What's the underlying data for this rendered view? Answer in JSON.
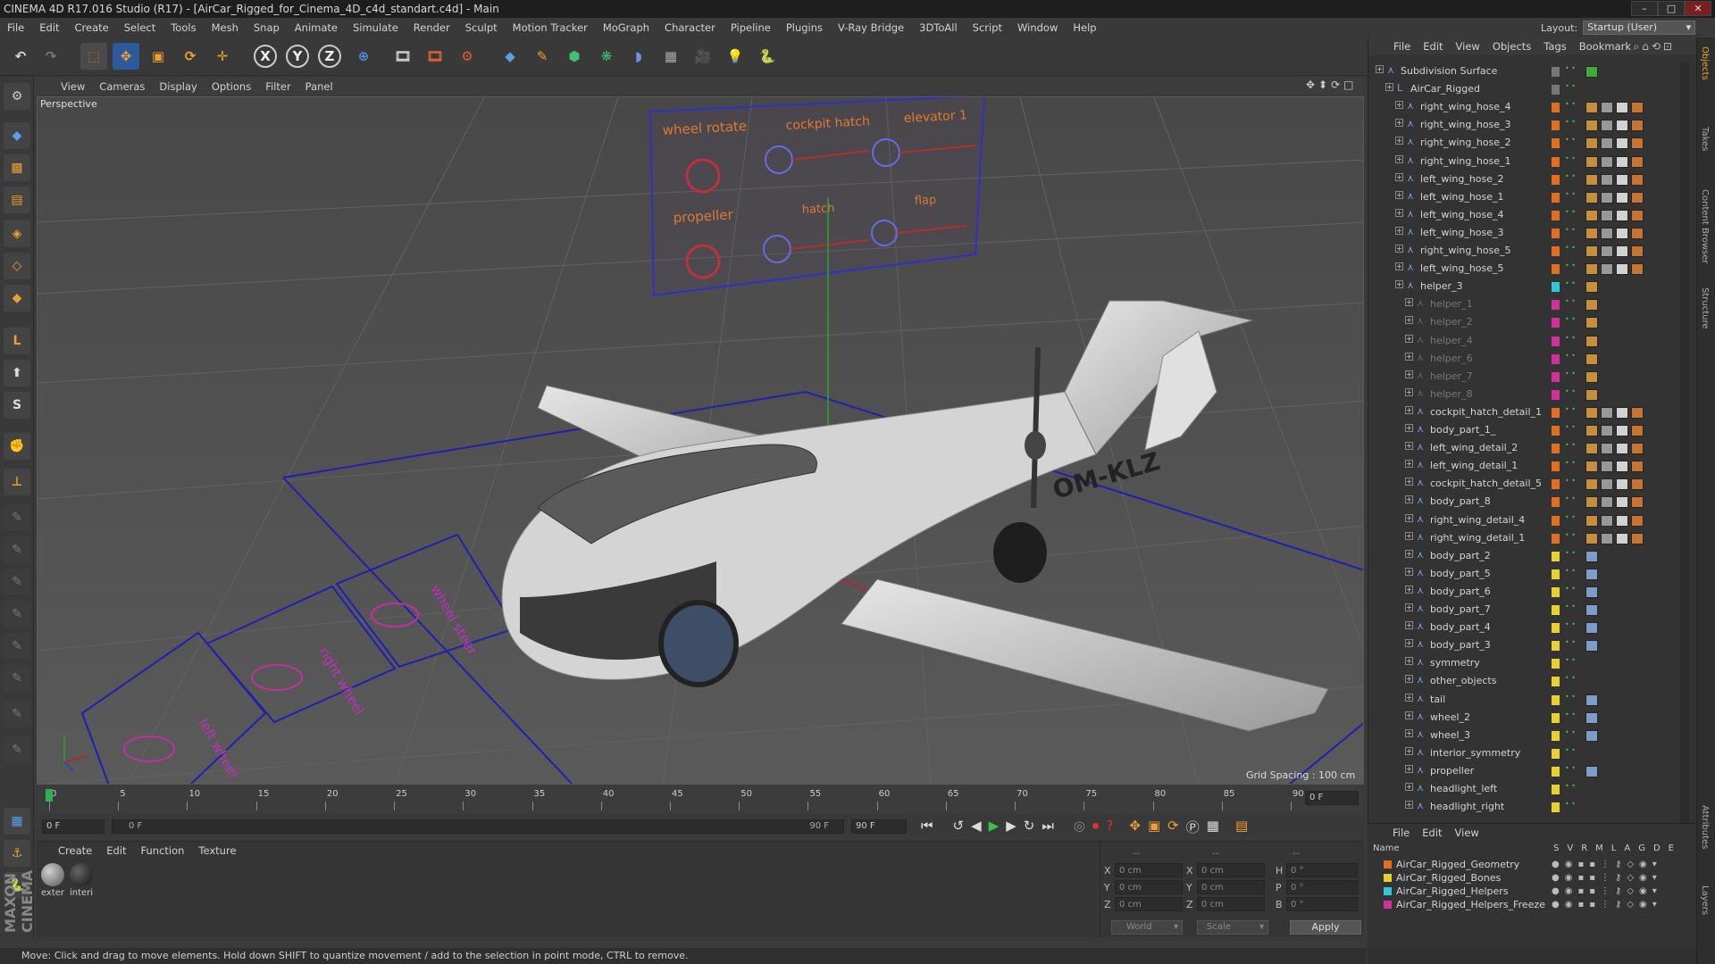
{
  "window": {
    "title": "CINEMA 4D R17.016 Studio (R17) - [AirCar_Rigged_for_Cinema_4D_c4d_standart.c4d] - Main",
    "layout_label": "Layout:",
    "layout_value": "Startup (User)"
  },
  "menubar": [
    "File",
    "Edit",
    "Create",
    "Select",
    "Tools",
    "Mesh",
    "Snap",
    "Animate",
    "Simulate",
    "Render",
    "Sculpt",
    "Motion Tracker",
    "MoGraph",
    "Character",
    "Pipeline",
    "Plugins",
    "V-Ray Bridge",
    "3DToAll",
    "Script",
    "Window",
    "Help"
  ],
  "toolbar": {
    "axis_x": "X",
    "axis_y": "Y",
    "axis_z": "Z"
  },
  "viewport": {
    "menu": [
      "View",
      "Cameras",
      "Display",
      "Options",
      "Filter",
      "Panel"
    ],
    "label": "Perspective",
    "grid_spacing": "Grid Spacing : 100 cm",
    "plane_registration": "OM-KLZ",
    "control_labels": [
      "wheel rotate",
      "cockpit hatch",
      "elevator 1",
      "propeller",
      "hatch",
      "flap"
    ],
    "ground_labels": [
      "left wheel",
      "right wheel",
      "wheel steer"
    ]
  },
  "timeline": {
    "ticks": [
      "0",
      "5",
      "10",
      "15",
      "20",
      "25",
      "30",
      "35",
      "40",
      "45",
      "50",
      "55",
      "60",
      "65",
      "70",
      "75",
      "80",
      "85",
      "90"
    ],
    "current_frame": "0 F",
    "start_frame": "0 F",
    "range_start": "0 F",
    "range_end": "90 F",
    "end_frame": "90 F"
  },
  "material_manager": {
    "menu": [
      "Create",
      "Edit",
      "Function",
      "Texture"
    ],
    "materials": [
      {
        "name": "exter"
      },
      {
        "name": "interi"
      }
    ]
  },
  "coordinates": {
    "headers": [
      "--",
      "--",
      "--"
    ],
    "rows": [
      {
        "axis": "X",
        "pos": "0 cm",
        "size_axis": "X",
        "size": "0 cm",
        "rot_axis": "H",
        "rot": "0 °"
      },
      {
        "axis": "Y",
        "pos": "0 cm",
        "size_axis": "Y",
        "size": "0 cm",
        "rot_axis": "P",
        "rot": "0 °"
      },
      {
        "axis": "Z",
        "pos": "0 cm",
        "size_axis": "Z",
        "size": "0 cm",
        "rot_axis": "B",
        "rot": "0 °"
      }
    ],
    "world": "World",
    "scale": "Scale",
    "apply": "Apply"
  },
  "status": "Move: Click and drag to move elements. Hold down SHIFT to quantize movement / add to the selection in point mode, CTRL to remove.",
  "object_manager": {
    "menu": [
      "File",
      "Edit",
      "View",
      "Objects",
      "Tags",
      "Bookmark"
    ],
    "objects": [
      {
        "name": "Subdivision Surface",
        "indent": 0,
        "color": "#777777",
        "dim": false,
        "tags": "check"
      },
      {
        "name": "AirCar_Rigged",
        "indent": 1,
        "color": "#777777",
        "dim": false,
        "tags": "none"
      },
      {
        "name": "right_wing_hose_4",
        "indent": 2,
        "color": "#e07020",
        "dim": false,
        "tags": "full"
      },
      {
        "name": "right_wing_hose_3",
        "indent": 2,
        "color": "#e07020",
        "dim": false,
        "tags": "full"
      },
      {
        "name": "right_wing_hose_2",
        "indent": 2,
        "color": "#e07020",
        "dim": false,
        "tags": "full"
      },
      {
        "name": "right_wing_hose_1",
        "indent": 2,
        "color": "#e07020",
        "dim": false,
        "tags": "full"
      },
      {
        "name": "left_wing_hose_2",
        "indent": 2,
        "color": "#e07020",
        "dim": false,
        "tags": "full"
      },
      {
        "name": "left_wing_hose_1",
        "indent": 2,
        "color": "#e07020",
        "dim": false,
        "tags": "full"
      },
      {
        "name": "left_wing_hose_4",
        "indent": 2,
        "color": "#e07020",
        "dim": false,
        "tags": "full"
      },
      {
        "name": "left_wing_hose_3",
        "indent": 2,
        "color": "#e07020",
        "dim": false,
        "tags": "full"
      },
      {
        "name": "right_wing_hose_5",
        "indent": 2,
        "color": "#e07020",
        "dim": false,
        "tags": "full"
      },
      {
        "name": "left_wing_hose_5",
        "indent": 2,
        "color": "#e07020",
        "dim": false,
        "tags": "full"
      },
      {
        "name": "helper_3",
        "indent": 2,
        "color": "#30c8d8",
        "dim": false,
        "tags": "one"
      },
      {
        "name": "helper_1",
        "indent": 3,
        "color": "#d0309a",
        "dim": true,
        "tags": "one"
      },
      {
        "name": "helper_2",
        "indent": 3,
        "color": "#d0309a",
        "dim": true,
        "tags": "one"
      },
      {
        "name": "helper_4",
        "indent": 3,
        "color": "#d0309a",
        "dim": true,
        "tags": "one"
      },
      {
        "name": "helper_6",
        "indent": 3,
        "color": "#d0309a",
        "dim": true,
        "tags": "one"
      },
      {
        "name": "helper_7",
        "indent": 3,
        "color": "#d0309a",
        "dim": true,
        "tags": "one"
      },
      {
        "name": "helper_8",
        "indent": 3,
        "color": "#d0309a",
        "dim": true,
        "tags": "one"
      },
      {
        "name": "cockpit_hatch_detail_1",
        "indent": 3,
        "color": "#e07020",
        "dim": false,
        "tags": "full"
      },
      {
        "name": "body_part_1_",
        "indent": 3,
        "color": "#e07020",
        "dim": false,
        "tags": "full"
      },
      {
        "name": "left_wing_detail_2",
        "indent": 3,
        "color": "#e07020",
        "dim": false,
        "tags": "full"
      },
      {
        "name": "left_wing_detail_1",
        "indent": 3,
        "color": "#e07020",
        "dim": false,
        "tags": "full"
      },
      {
        "name": "cockpit_hatch_detail_5",
        "indent": 3,
        "color": "#e07020",
        "dim": false,
        "tags": "full"
      },
      {
        "name": "body_part_8",
        "indent": 3,
        "color": "#e07020",
        "dim": false,
        "tags": "full"
      },
      {
        "name": "right_wing_detail_4",
        "indent": 3,
        "color": "#e07020",
        "dim": false,
        "tags": "full"
      },
      {
        "name": "right_wing_detail_1",
        "indent": 3,
        "color": "#e07020",
        "dim": false,
        "tags": "full"
      },
      {
        "name": "body_part_2",
        "indent": 3,
        "color": "#e8d030",
        "dim": false,
        "tags": "dots"
      },
      {
        "name": "body_part_5",
        "indent": 3,
        "color": "#e8d030",
        "dim": false,
        "tags": "dots"
      },
      {
        "name": "body_part_6",
        "indent": 3,
        "color": "#e8d030",
        "dim": false,
        "tags": "dots"
      },
      {
        "name": "body_part_7",
        "indent": 3,
        "color": "#e8d030",
        "dim": false,
        "tags": "dots"
      },
      {
        "name": "body_part_4",
        "indent": 3,
        "color": "#e8d030",
        "dim": false,
        "tags": "dots"
      },
      {
        "name": "body_part_3",
        "indent": 3,
        "color": "#e8d030",
        "dim": false,
        "tags": "dots"
      },
      {
        "name": "symmetry",
        "indent": 3,
        "color": "#e8d030",
        "dim": false,
        "tags": "none"
      },
      {
        "name": "other_objects",
        "indent": 3,
        "color": "#e8d030",
        "dim": false,
        "tags": "none"
      },
      {
        "name": "tail",
        "indent": 3,
        "color": "#e8d030",
        "dim": false,
        "tags": "dots"
      },
      {
        "name": "wheel_2",
        "indent": 3,
        "color": "#e8d030",
        "dim": false,
        "tags": "dots"
      },
      {
        "name": "wheel_3",
        "indent": 3,
        "color": "#e8d030",
        "dim": false,
        "tags": "dots"
      },
      {
        "name": "interior_symmetry",
        "indent": 3,
        "color": "#e8d030",
        "dim": false,
        "tags": "none"
      },
      {
        "name": "propeller",
        "indent": 3,
        "color": "#e8d030",
        "dim": false,
        "tags": "dots"
      },
      {
        "name": "headlight_left",
        "indent": 3,
        "color": "#e8d030",
        "dim": false,
        "tags": "none"
      },
      {
        "name": "headlight_right",
        "indent": 3,
        "color": "#e8d030",
        "dim": false,
        "tags": "none"
      }
    ]
  },
  "layer_manager": {
    "menu": [
      "File",
      "Edit",
      "View"
    ],
    "header_name": "Name",
    "columns": [
      "S",
      "V",
      "R",
      "M",
      "L",
      "A",
      "G",
      "D",
      "E"
    ],
    "layers": [
      {
        "name": "AirCar_Rigged_Geometry",
        "color": "#e07020"
      },
      {
        "name": "AirCar_Rigged_Bones",
        "color": "#e8d030"
      },
      {
        "name": "AirCar_Rigged_Helpers",
        "color": "#30c8d8"
      },
      {
        "name": "AirCar_Rigged_Helpers_Freeze",
        "color": "#d0309a"
      }
    ]
  },
  "side_tabs": [
    "Objects",
    "Takes",
    "Content Browser",
    "Structure",
    "Attributes",
    "Layers"
  ]
}
